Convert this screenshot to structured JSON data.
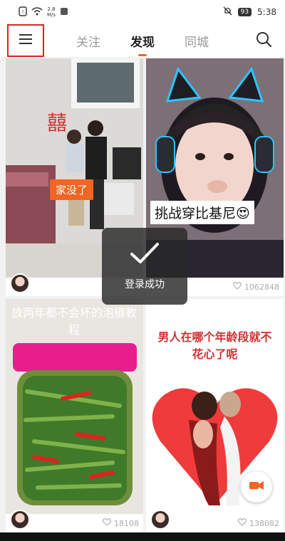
{
  "status_bar": {
    "net_speed_value": "2.8",
    "net_speed_unit": "M/s",
    "battery": "93",
    "time": "5:38"
  },
  "nav": {
    "tabs": [
      {
        "label": "关注",
        "active": false
      },
      {
        "label": "发现",
        "active": true
      },
      {
        "label": "同城",
        "active": false
      }
    ],
    "menu_icon": "hamburger-menu-icon",
    "search_icon": "search-icon"
  },
  "feed": {
    "cards": [
      {
        "caption": "家没了",
        "likes": ""
      },
      {
        "caption": "挑战穿比基尼😍",
        "likes": "1062848"
      },
      {
        "caption": "放两年都不会坏的泡椒教程",
        "likes": "18108"
      },
      {
        "caption": "男人在哪个年龄段就不花心了呢",
        "likes": "138082"
      }
    ]
  },
  "toast": {
    "text": "登录成功"
  },
  "colors": {
    "accent": "#f26522",
    "highlight_box": "#e02020"
  }
}
